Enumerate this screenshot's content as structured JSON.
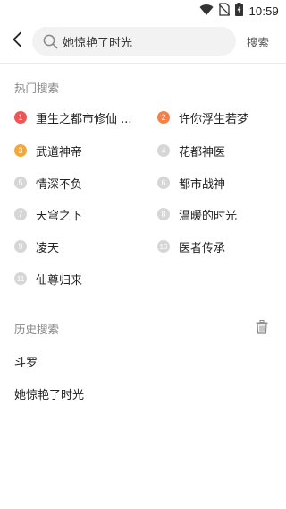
{
  "status_bar": {
    "time": "10:59",
    "icons": [
      "wifi-icon",
      "no-sim-icon",
      "battery-charging-icon"
    ]
  },
  "search": {
    "value": "她惊艳了时光",
    "button_label": "搜索"
  },
  "hot_section": {
    "title": "热门搜索",
    "items": [
      {
        "rank": "1",
        "label": "重生之都市修仙 ..."
      },
      {
        "rank": "2",
        "label": "许你浮生若梦"
      },
      {
        "rank": "3",
        "label": "武道神帝"
      },
      {
        "rank": "4",
        "label": "花都神医"
      },
      {
        "rank": "5",
        "label": "情深不负"
      },
      {
        "rank": "6",
        "label": "都市战神"
      },
      {
        "rank": "7",
        "label": "天穹之下"
      },
      {
        "rank": "8",
        "label": "温暖的时光"
      },
      {
        "rank": "9",
        "label": "凌天"
      },
      {
        "rank": "10",
        "label": "医者传承"
      },
      {
        "rank": "11",
        "label": "仙尊归来"
      }
    ]
  },
  "history_section": {
    "title": "历史搜索",
    "items": [
      "斗罗",
      "她惊艳了时光"
    ]
  },
  "colors": {
    "rank1": "#f05454",
    "rank2": "#f6804a",
    "rank3": "#f5a83a",
    "rank_other": "#d6d6d6"
  }
}
